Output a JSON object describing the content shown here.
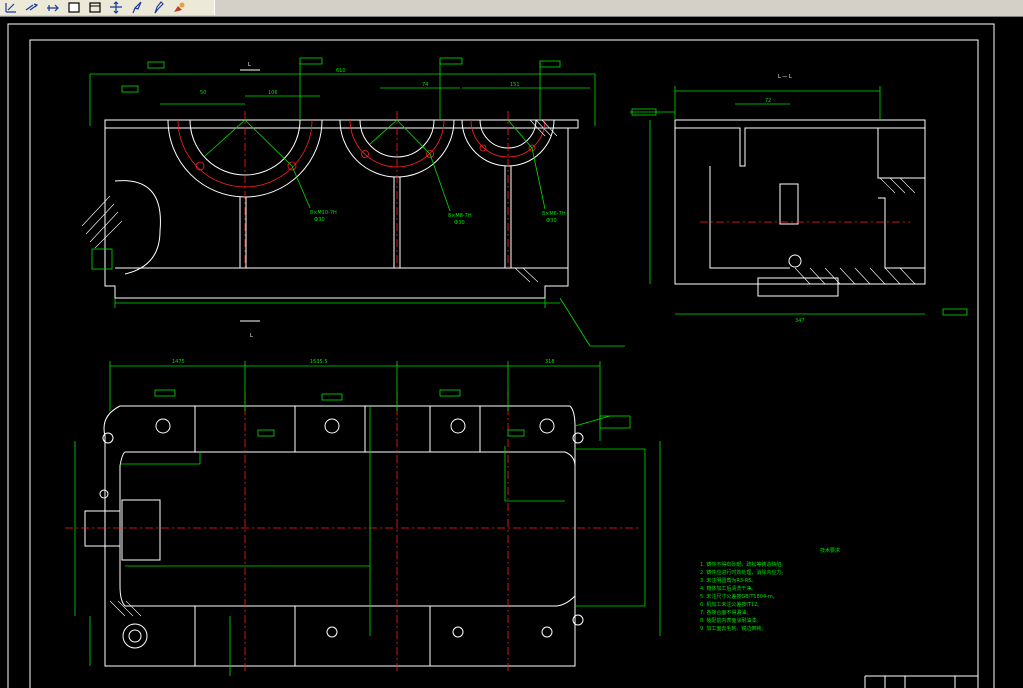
{
  "toolbar": {
    "icons": [
      "dimension-icon",
      "line-arrow-icon",
      "arrow-icon",
      "rectangle-icon",
      "square-icon",
      "move-icon",
      "pen-icon",
      "pencil-icon",
      "paint-icon"
    ]
  },
  "colors": {
    "background": "#000000",
    "outline": "#ffffff",
    "dimension": "#00e000",
    "centerline": "#ff2020",
    "toolbar": "#d4d0c8"
  },
  "drawing": {
    "section_mark_top": "L",
    "section_mark_bottom": "L",
    "section_view_title": "L — L",
    "holes": [
      {
        "label": "8×M10-7H",
        "depth": "Ф30"
      },
      {
        "label": "8×M8-7H",
        "depth": "Ф30"
      },
      {
        "label": "8×M6-7H",
        "depth": "Ф30"
      }
    ],
    "dims_front": {
      "d1": "50",
      "d2": "106",
      "d3": "74",
      "d4": "151",
      "overall": "610"
    },
    "dims_side": {
      "a": "72",
      "b": "347"
    },
    "dims_plan": {
      "d1": "1475",
      "d2": "1535.5",
      "d3": "318"
    },
    "tech_req_title": "技术要求",
    "tech_requirements": [
      "1. 铸件不得有砂眼、疏松等铸造缺陷。",
      "2. 铸件应进行时效处理，消除内应力。",
      "3. 未注明圆角为R3-R5。",
      "4. 箱体加工后清洗干净。",
      "5. 未注尺寸公差按GB/T1804-m。",
      "6. 机加工未注公差按IT12。",
      "7. 各接合面不得漏油。",
      "8. 装配前内表面涂耐油漆。",
      "9. 加工面去毛刺、锐边倒钝。"
    ]
  }
}
